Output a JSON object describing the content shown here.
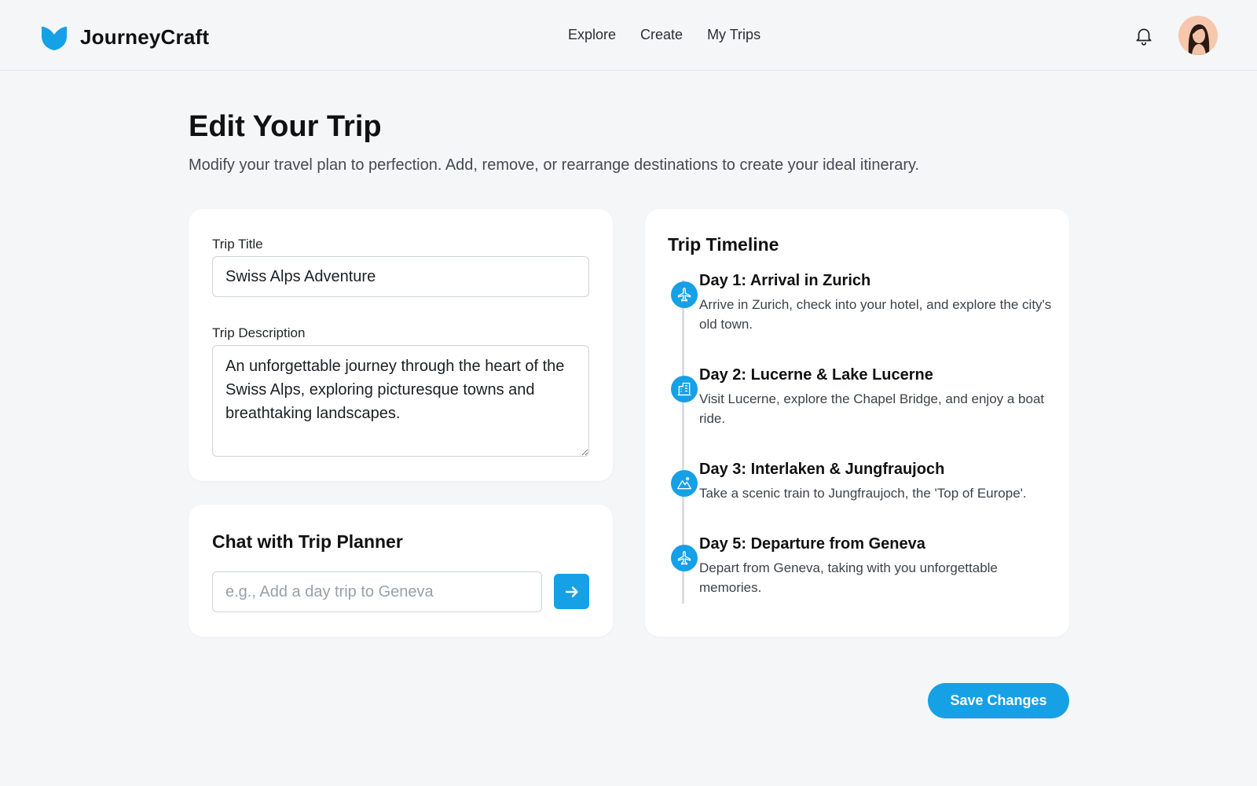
{
  "brand": {
    "name": "JourneyCraft",
    "logo_icon": "heart-shaped-logo-icon"
  },
  "nav": {
    "items": [
      "Explore",
      "Create",
      "My Trips"
    ]
  },
  "header_icons": {
    "notifications": "bell-icon",
    "avatar": "user-avatar"
  },
  "page": {
    "title": "Edit Your Trip",
    "subtitle": "Modify your travel plan to perfection. Add, remove, or rearrange destinations to create your ideal itinerary."
  },
  "form": {
    "title_label": "Trip Title",
    "title_value": "Swiss Alps Adventure",
    "description_label": "Trip Description",
    "description_value": "An unforgettable journey through the heart of the Swiss Alps, exploring picturesque towns and breathtaking landscapes."
  },
  "chat": {
    "title": "Chat with Trip Planner",
    "placeholder": "e.g., Add a day trip to Geneva",
    "send_icon": "arrow-right-icon"
  },
  "timeline": {
    "title": "Trip Timeline",
    "items": [
      {
        "heading": "Day 1: Arrival in Zurich",
        "description": "Arrive in Zurich, check into your hotel, and explore the city's old town.",
        "icon": "airplane-icon"
      },
      {
        "heading": "Day 2: Lucerne & Lake Lucerne",
        "description": "Visit Lucerne, explore the Chapel Bridge, and enjoy a boat ride.",
        "icon": "building-icon"
      },
      {
        "heading": "Day 3: Interlaken & Jungfraujoch",
        "description": "Take a scenic train to Jungfraujoch, the 'Top of Europe'.",
        "icon": "mountain-icon"
      },
      {
        "heading": "Day 5: Departure from Geneva",
        "description": "Depart from Geneva, taking with you unforgettable memories.",
        "icon": "airplane-icon"
      }
    ]
  },
  "actions": {
    "save_label": "Save Changes"
  },
  "colors": {
    "accent": "#16a0e6",
    "background": "#f5f6f8",
    "card": "#ffffff"
  }
}
